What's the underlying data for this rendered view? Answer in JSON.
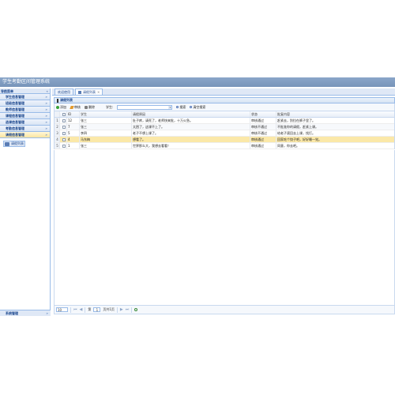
{
  "app": {
    "title": "学生考勤区间管理系统"
  },
  "sidebar": {
    "header": "导航菜单",
    "collapse": "«",
    "items": [
      {
        "label": "学生信息管理"
      },
      {
        "label": "班级信息管理"
      },
      {
        "label": "教师信息管理"
      },
      {
        "label": "课程信息管理"
      },
      {
        "label": "选课信息管理"
      },
      {
        "label": "考勤信息管理"
      },
      {
        "label": "请假信息管理"
      }
    ],
    "active_sub": "请假列表",
    "bottom": "系统管理",
    "chevron": "»"
  },
  "tabs": [
    {
      "label": "欢迎使用"
    },
    {
      "label": "请假列表",
      "close": "×"
    }
  ],
  "panel": {
    "title": "请假列表"
  },
  "toolbar": {
    "add": "添加",
    "edit": "审核",
    "delete": "删除",
    "name_label": "学生:",
    "name_value": "",
    "search": "搜索",
    "clear": "清空搜索"
  },
  "grid": {
    "headers": {
      "id": "ID",
      "name": "学生",
      "reason": "请假原因",
      "status": "状态",
      "reply": "批复内容"
    },
    "rows": [
      {
        "num": "1",
        "id": "12",
        "name": "张三",
        "reason": "肚子疼，请死了，老师快来批，十万火急。",
        "status": "审核通过",
        "reply": "赶紧去，别拉在裤子里了。"
      },
      {
        "num": "2",
        "id": "7",
        "name": "张三",
        "reason": "太困了，这课不上了。",
        "status": "审核不通过",
        "reply": "不批准你的请假，赶紧上课。"
      },
      {
        "num": "3",
        "id": "5",
        "name": "李四",
        "reason": "老子不想上课了。",
        "status": "审核不通过",
        "reply": "给老子滚回去上课，找打。"
      },
      {
        "num": "4",
        "id": "4",
        "name": "马东梅",
        "reason": "想看了。",
        "status": "审核通过",
        "reply": "回家吃个饺子吧，好好睡一觉。"
      },
      {
        "num": "5",
        "id": "1",
        "name": "张三",
        "reason": "世界那么大，我想去看看！",
        "status": "审核通过",
        "reply": "同意，你去吧。"
      }
    ]
  },
  "pager": {
    "page_size": "10",
    "first": "⏮",
    "prev": "◀",
    "page_label": "第",
    "page_value": "1",
    "total": "页共1页",
    "next": "▶",
    "last": "⏭"
  },
  "colors": {
    "title_bar": "#7f9cc1",
    "border": "#99bbe8",
    "selected_row": "#fbe8a8"
  }
}
